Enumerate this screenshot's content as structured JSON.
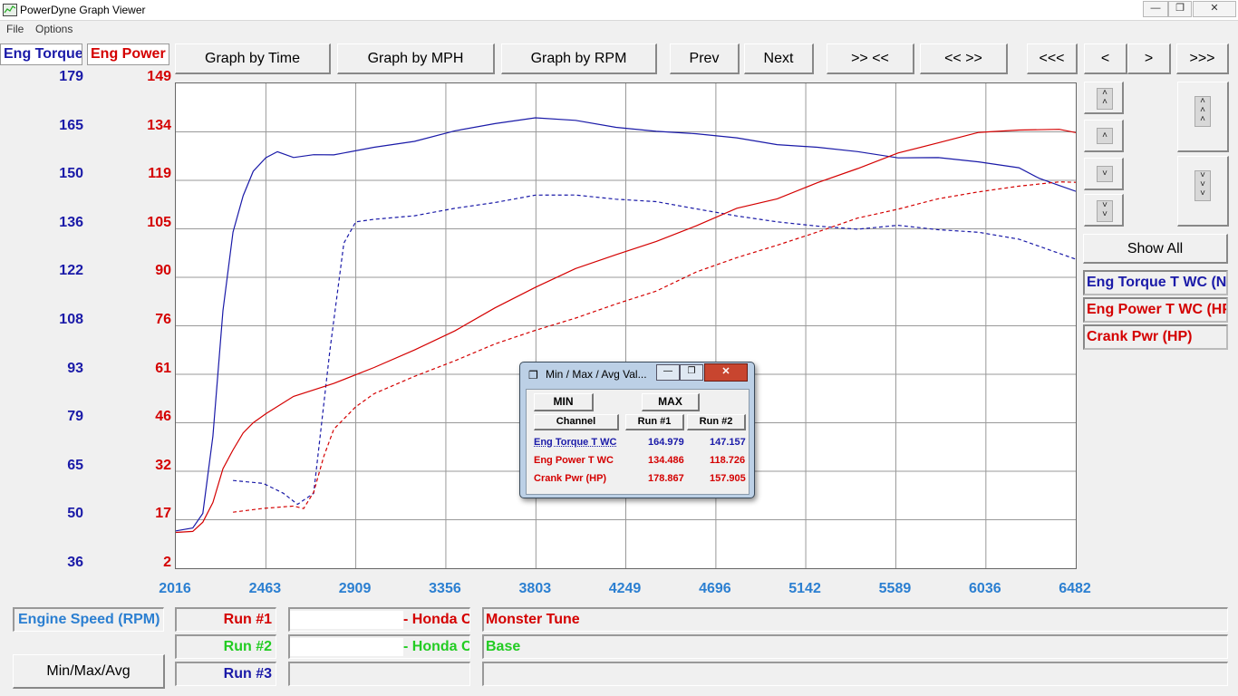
{
  "window": {
    "title": "PowerDyne Graph Viewer",
    "minimize_icon": "minimize-icon",
    "restore_icon": "restore-icon",
    "close_icon": "close-icon"
  },
  "menu": {
    "file": "File",
    "options": "Options"
  },
  "legend_top": {
    "torque": "Eng Torque",
    "power": "Eng Power"
  },
  "toolbar": {
    "by_time": "Graph by Time",
    "by_mph": "Graph by MPH",
    "by_rpm": "Graph by RPM",
    "prev": "Prev",
    "next": "Next",
    "zoom_in": ">> <<",
    "zoom_out": "<< >>",
    "first": "<<<",
    "back": "<",
    "forward": ">",
    "last": ">>>"
  },
  "colors": {
    "torque": "#1a1aa8",
    "power": "#d40000",
    "xaxis": "#2b7fd1",
    "run2": "#22cc22",
    "grid": "#999999"
  },
  "chart_data": {
    "type": "line",
    "x_label": "Engine Speed (RPM)",
    "x_ticks": [
      2016,
      2463,
      2909,
      3356,
      3803,
      4249,
      4696,
      5142,
      5589,
      6036,
      6482
    ],
    "y_left_ticks": [
      179,
      165,
      150,
      136,
      122,
      108,
      93,
      79,
      65,
      50,
      36
    ],
    "y_right_ticks": [
      149,
      134,
      119,
      105,
      90,
      76,
      61,
      46,
      32,
      17,
      2
    ],
    "y_left_range": [
      36,
      179
    ],
    "y_right_range": [
      2,
      149
    ],
    "series": [
      {
        "name": "Eng Torque T WC (Run #1)",
        "axis": "left",
        "color": "#1a1aa8",
        "dash": false,
        "x": [
          2016,
          2100,
          2150,
          2200,
          2250,
          2300,
          2350,
          2400,
          2463,
          2520,
          2600,
          2700,
          2800,
          3000,
          3200,
          3400,
          3600,
          3800,
          4000,
          4200,
          4400,
          4600,
          4800,
          5000,
          5200,
          5400,
          5600,
          5800,
          6000,
          6200,
          6300,
          6400,
          6482
        ],
        "y": [
          47,
          48,
          52,
          75,
          112,
          135,
          146,
          153,
          157,
          159,
          157,
          158,
          158,
          160,
          162,
          165,
          167,
          169,
          168,
          166,
          165,
          164,
          163,
          161,
          160,
          159,
          157,
          157,
          156,
          154,
          151,
          149,
          147
        ]
      },
      {
        "name": "Eng Torque T WC (Run #2)",
        "axis": "left",
        "color": "#1a1aa8",
        "dash": true,
        "x": [
          2300,
          2450,
          2550,
          2620,
          2700,
          2780,
          2850,
          2909,
          3000,
          3200,
          3400,
          3600,
          3800,
          4000,
          4200,
          4400,
          4600,
          4800,
          5000,
          5200,
          5400,
          5600,
          5800,
          6000,
          6200,
          6400,
          6482
        ],
        "y": [
          62,
          61,
          58,
          55,
          58,
          100,
          132,
          138,
          139,
          140,
          142,
          144,
          146,
          146,
          145,
          144,
          142,
          140,
          138,
          137,
          136,
          137,
          136,
          135,
          133,
          129,
          127
        ]
      },
      {
        "name": "Eng Power T WC (Run #1)",
        "axis": "right",
        "color": "#d40000",
        "dash": false,
        "x": [
          2016,
          2100,
          2150,
          2200,
          2250,
          2300,
          2350,
          2400,
          2463,
          2600,
          2800,
          3000,
          3200,
          3400,
          3600,
          3800,
          4000,
          4200,
          4400,
          4600,
          4800,
          5000,
          5200,
          5400,
          5600,
          5800,
          6000,
          6200,
          6400,
          6482
        ],
        "y": [
          13,
          13,
          16,
          22,
          32,
          38,
          43,
          46,
          49,
          54,
          58,
          63,
          68,
          74,
          81,
          87,
          93,
          97,
          101,
          106,
          111,
          114,
          119,
          123,
          128,
          131,
          134,
          135,
          135,
          134
        ]
      },
      {
        "name": "Eng Power T WC (Run #2)",
        "axis": "right",
        "color": "#d40000",
        "dash": true,
        "x": [
          2300,
          2450,
          2600,
          2650,
          2700,
          2750,
          2800,
          2909,
          3000,
          3200,
          3400,
          3600,
          3800,
          4000,
          4200,
          4400,
          4600,
          4800,
          5000,
          5200,
          5400,
          5600,
          5800,
          6000,
          6200,
          6400,
          6482
        ],
        "y": [
          19,
          20,
          21,
          20,
          25,
          36,
          44,
          51,
          55,
          60,
          65,
          70,
          74,
          78,
          82,
          86,
          92,
          96,
          100,
          104,
          108,
          111,
          114,
          116,
          118,
          119,
          119
        ]
      }
    ]
  },
  "side_buttons": {
    "scroll_up_fast": "double-chevron-up-icon",
    "scroll_up": "chevron-up-icon",
    "scroll_down": "chevron-down-icon",
    "scroll_down_fast": "double-chevron-down-icon",
    "expand_up": "triple-chevron-up-icon",
    "expand_down": "triple-chevron-down-icon",
    "show_all": "Show All"
  },
  "channels": [
    "Eng Torque T WC (N",
    "Eng Power T WC (HP",
    "Crank Pwr (HP)"
  ],
  "dialog": {
    "title": "Min / Max / Avg Val...",
    "min_label": "MIN",
    "max_label": "MAX",
    "headers": [
      "Channel",
      "Run #1",
      "Run #2"
    ],
    "rows": [
      {
        "channel": "Eng Torque T WC",
        "run1": "164.979",
        "run2": "147.157",
        "color": "#1a1aa8"
      },
      {
        "channel": "Eng Power T WC",
        "run1": "134.486",
        "run2": "118.726",
        "color": "#d40000"
      },
      {
        "channel": "Crank Pwr (HP)",
        "run1": "178.867",
        "run2": "157.905",
        "color": "#d40000"
      }
    ]
  },
  "bottom": {
    "x_channel": "Engine Speed (RPM)",
    "minmax_button": "Min/Max/Avg",
    "run_labels": [
      "Run #1",
      "Run #2",
      "Run #3"
    ],
    "run_files": [
      "- Honda C",
      "- Honda C",
      ""
    ],
    "run_descs": [
      "Monster Tune",
      "Base",
      ""
    ]
  }
}
